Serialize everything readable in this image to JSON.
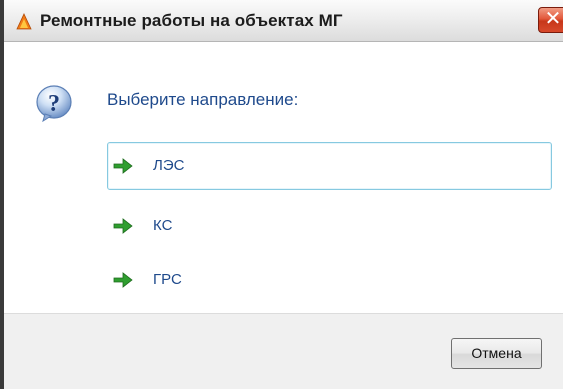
{
  "window": {
    "title": "Ремонтные работы на объектах МГ",
    "close_label": "✕",
    "icon": "flame-icon"
  },
  "dialog": {
    "question_icon": "question-icon",
    "prompt": "Выберите направление:",
    "options": [
      {
        "label": "ЛЭС",
        "icon": "green-arrow-icon",
        "selected": true
      },
      {
        "label": "КС",
        "icon": "green-arrow-icon",
        "selected": false
      },
      {
        "label": "ГРС",
        "icon": "green-arrow-icon",
        "selected": false
      }
    ]
  },
  "footer": {
    "cancel_label": "Отмена"
  },
  "colors": {
    "accent_text": "#1f4a8c",
    "arrow_green": "#2f9e2f",
    "selection_border": "#86c9e0",
    "close_red": "#d7492b"
  }
}
